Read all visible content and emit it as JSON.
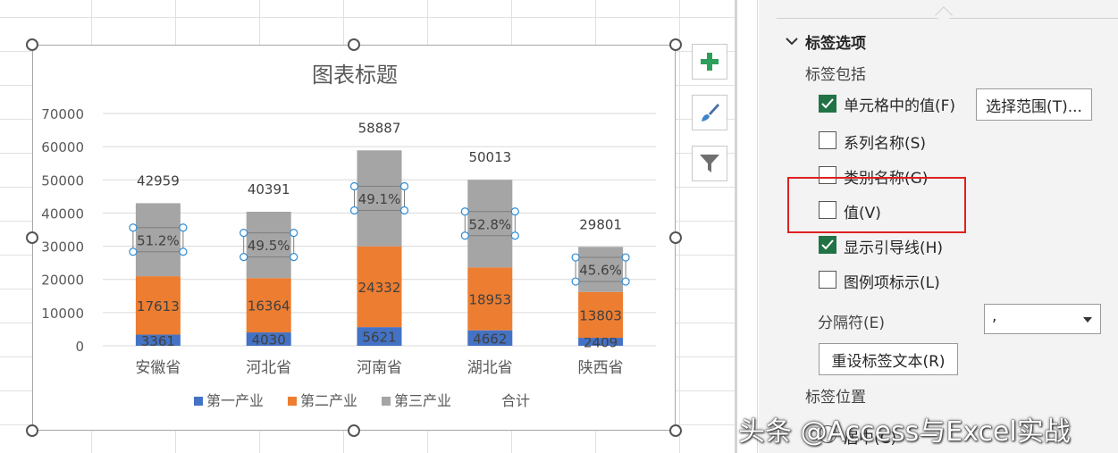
{
  "chart_data": {
    "type": "bar",
    "stacked": true,
    "title": "图表标题",
    "categories": [
      "安徽省",
      "河北省",
      "河南省",
      "湖北省",
      "陕西省"
    ],
    "series": [
      {
        "name": "第一产业",
        "color": "#4472c4",
        "values": [
          3361,
          4030,
          5621,
          4662,
          2409
        ]
      },
      {
        "name": "第二产业",
        "color": "#ed7d31",
        "values": [
          17613,
          16364,
          24332,
          18953,
          13803
        ]
      },
      {
        "name": "第三产业",
        "color": "#a5a5a5",
        "values": [
          21985,
          19997,
          28934,
          26398,
          13589
        ]
      }
    ],
    "totals": [
      42959,
      40391,
      58887,
      50013,
      29801
    ],
    "totals_series_name": "合计",
    "tertiary_share_labels": [
      "51.2%",
      "49.5%",
      "49.1%",
      "52.8%",
      "45.6%"
    ],
    "ylim": [
      0,
      70000
    ],
    "yticks": [
      0,
      10000,
      20000,
      30000,
      40000,
      50000,
      60000,
      70000
    ],
    "grid": true,
    "legend": "bottom"
  },
  "chart_tools": {
    "add_element": "plus-icon",
    "style": "brush-icon",
    "filter": "filter-icon"
  },
  "panel": {
    "section_title": "标签选项",
    "includes_label": "标签包括",
    "options": [
      {
        "label": "单元格中的值(F)",
        "checked": true
      },
      {
        "label": "系列名称(S)",
        "checked": false
      },
      {
        "label": "类别名称(G)",
        "checked": false
      },
      {
        "label": "值(V)",
        "checked": false
      },
      {
        "label": "显示引导线(H)",
        "checked": true
      },
      {
        "label": "图例项标示(L)",
        "checked": false
      }
    ],
    "select_range_button": "选择范围(T)...",
    "separator_label": "分隔符(E)",
    "separator_value": ",",
    "reset_button": "重设标签文本(R)",
    "position_label": "标签位置",
    "position_first": "居中(C)"
  },
  "watermark": "头条 @Access与Excel实战",
  "colors": {
    "accent_green": "#217346",
    "highlight_red": "#e02020"
  }
}
